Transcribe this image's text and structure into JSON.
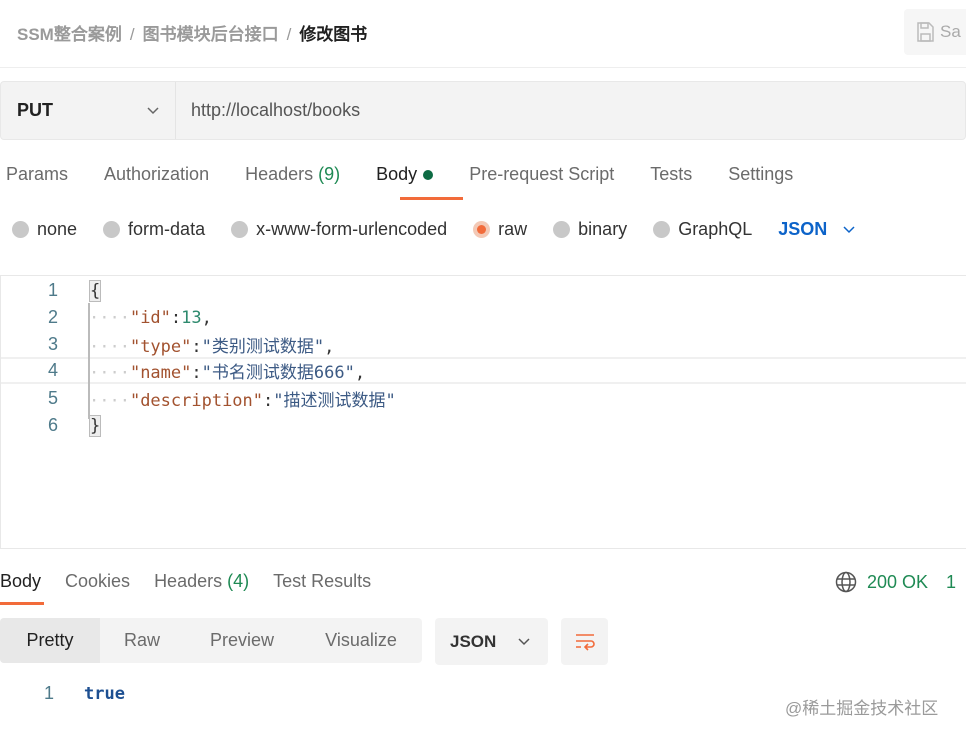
{
  "breadcrumb": {
    "items": [
      "SSM整合案例",
      "图书模块后台接口"
    ],
    "current": "修改图书",
    "separator": "/"
  },
  "save_label": "Sa",
  "request": {
    "method": "PUT",
    "url": "http://localhost/books"
  },
  "tabs": [
    {
      "label": "Params"
    },
    {
      "label": "Authorization"
    },
    {
      "label": "Headers",
      "count": "(9)"
    },
    {
      "label": "Body",
      "active": true
    },
    {
      "label": "Pre-request Script"
    },
    {
      "label": "Tests"
    },
    {
      "label": "Settings"
    }
  ],
  "body_types": [
    "none",
    "form-data",
    "x-www-form-urlencoded",
    "raw",
    "binary",
    "GraphQL"
  ],
  "body_type_selected": "raw",
  "body_format": "JSON",
  "editor": {
    "line_numbers": [
      "1",
      "2",
      "3",
      "4",
      "5",
      "6"
    ],
    "lines": [
      {
        "open": "{"
      },
      {
        "key": "\"id\"",
        "value": "13",
        "value_type": "number",
        "trail": ","
      },
      {
        "key": "\"type\"",
        "value": "\"类别测试数据\"",
        "value_type": "string",
        "trail": ","
      },
      {
        "key": "\"name\"",
        "value": "\"书名测试数据666\"",
        "value_type": "string",
        "trail": ","
      },
      {
        "key": "\"description\"",
        "value": "\"描述测试数据\"",
        "value_type": "string",
        "trail": ""
      },
      {
        "close": "}"
      }
    ]
  },
  "response": {
    "tabs": [
      {
        "label": "Body"
      },
      {
        "label": "Cookies"
      },
      {
        "label": "Headers",
        "count": "(4)"
      },
      {
        "label": "Test Results"
      }
    ],
    "status": "200 OK",
    "status_extra": "1",
    "views": [
      "Pretty",
      "Raw",
      "Preview",
      "Visualize"
    ],
    "format": "JSON",
    "line_number": "1",
    "value": "true"
  },
  "watermark": "@稀土掘金技术社区",
  "colors": {
    "accent": "#f26b3a",
    "success": "#1f8a54",
    "link": "#0c63c9"
  }
}
